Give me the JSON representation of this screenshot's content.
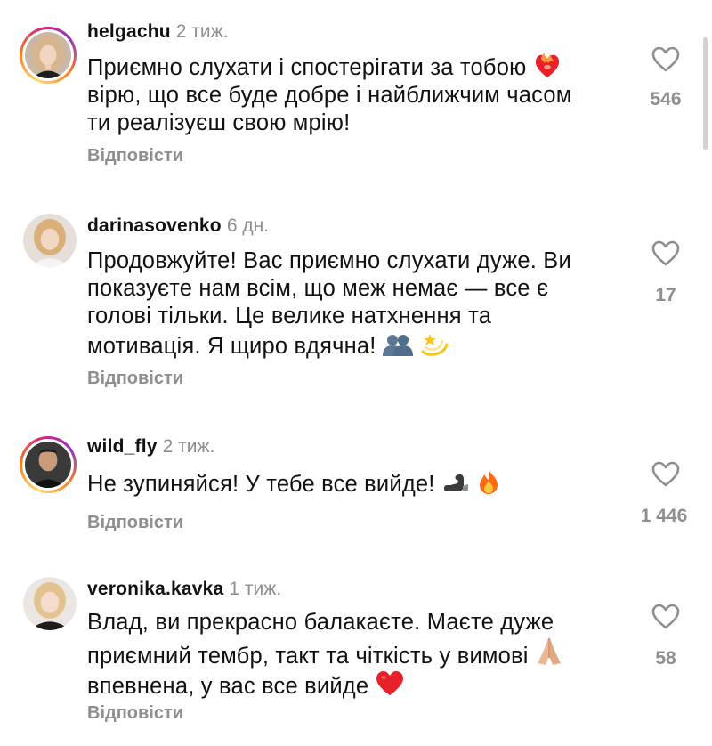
{
  "comments": [
    {
      "username": "helgachu",
      "time": "2 тиж.",
      "lines": [
        "Приємно слухати і спостерігати за тобою",
        "вірю, що все буде добре і найближчим часом",
        "ти реалізуєш свою мрію!"
      ],
      "reply": "Відповісти",
      "likes": "546",
      "has_story_ring": true,
      "emojis": [
        "heart-on-fire"
      ]
    },
    {
      "username": "darinasovenko",
      "time": "6 дн.",
      "lines": [
        "Продовжуйте! Вас приємно слухати дуже. Ви",
        "показуєте нам всім, що меж немає — все є",
        "голові тільки. Це велике натхнення та",
        "мотивація. Я щиро вдячна!"
      ],
      "reply": "Відповісти",
      "likes": "17",
      "has_story_ring": false,
      "emojis": [
        "two-silhouettes",
        "dizzy-star"
      ]
    },
    {
      "username": "wild_fly",
      "time": "2 тиж.",
      "lines": [
        "Не зупиняйся! У тебе все вийде!"
      ],
      "reply": "Відповісти",
      "likes": "1 446",
      "has_story_ring": true,
      "emojis": [
        "flexed-biceps",
        "fire"
      ]
    },
    {
      "username": "veronika.kavka",
      "time": "1 тиж.",
      "lines": [
        "Влад, ви прекрасно балакаєте. Маєте дуже",
        "приємний тембр, такт та чіткість у вимові",
        "впевнена, у вас все вийде"
      ],
      "reply": "Відповісти",
      "likes": "58",
      "has_story_ring": false,
      "emojis": [
        "folded-hands",
        "red-heart"
      ]
    }
  ],
  "colors": {
    "text": "#111111",
    "muted": "#8e8e8e",
    "background": "#ffffff",
    "heart_red": "#e8202a",
    "fire_orange": "#ff7a1a"
  }
}
